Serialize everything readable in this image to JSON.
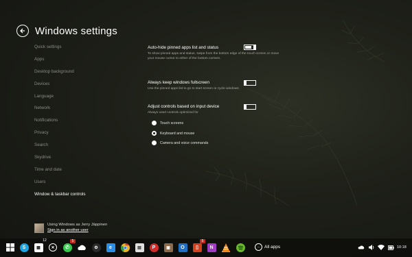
{
  "header": {
    "title": "Windows settings"
  },
  "sidebar": {
    "items": [
      {
        "label": "Quick settings"
      },
      {
        "label": "Apps"
      },
      {
        "label": "Desktop background"
      },
      {
        "label": "Devices"
      },
      {
        "label": "Language"
      },
      {
        "label": "Network"
      },
      {
        "label": "Notifications"
      },
      {
        "label": "Privacy"
      },
      {
        "label": "Search"
      },
      {
        "label": "Skydrive"
      },
      {
        "label": "Time and date"
      },
      {
        "label": "Users"
      },
      {
        "label": "Window & taskbar controls",
        "active": true
      }
    ]
  },
  "user": {
    "line1": "Using Windows as Jerry Jäppinen",
    "line2": "Sign in as another user"
  },
  "settings": {
    "autohide": {
      "title": "Auto-hide pinned apps list and status",
      "desc": "To show pinned apps and status, swipe from the bottom edge of the touch screen or move your mouse cursor to either of the bottom corners.",
      "state": "on"
    },
    "fullscreen": {
      "title": "Always keep windows fullscreen",
      "desc": "Use the pinned apps list to go to start screen or cycle windows.",
      "state": "off"
    },
    "adjust": {
      "title": "Adjust controls based on input device",
      "desc": "Always used controls optimized for",
      "state": "off",
      "options": [
        {
          "label": "Touch screens",
          "selected": false
        },
        {
          "label": "Keyboard and mouse",
          "selected": true
        },
        {
          "label": "Camera and voice commands",
          "selected": false
        }
      ]
    }
  },
  "taskbar": {
    "icons": [
      {
        "name": "windows-start-icon",
        "color": "#ffffff"
      },
      {
        "name": "skype-icon",
        "color": "#1aa3e0"
      },
      {
        "name": "calendar-icon",
        "color": "#ffffff",
        "badge": "12"
      },
      {
        "name": "xbox-icon",
        "color": "#ffffff"
      },
      {
        "name": "whatsapp-icon",
        "color": "#35c94d",
        "badge": "5"
      },
      {
        "name": "onedrive-icon",
        "color": "#ffffff"
      },
      {
        "name": "steam-icon",
        "color": "#d7d7d7"
      },
      {
        "name": "internet-explorer-icon",
        "color": "#2a8ee8"
      },
      {
        "name": "chrome-icon",
        "color": "#e8b623"
      },
      {
        "name": "news-icon",
        "color": "#e0e0e0"
      },
      {
        "name": "pinterest-icon",
        "color": "#d12a2a"
      },
      {
        "name": "photos-icon",
        "color": "#8a6a4a"
      },
      {
        "name": "outlook-icon",
        "color": "#1f6fc4"
      },
      {
        "name": "office-icon",
        "color": "#d2401e",
        "badge": "5"
      },
      {
        "name": "onenote-icon",
        "color": "#a03cc2"
      },
      {
        "name": "vlc-icon",
        "color": "#f08a1c"
      },
      {
        "name": "spotify-icon",
        "color": "#6ab62c"
      }
    ],
    "all_apps_label": "All apps",
    "clock": "10:18",
    "tray": [
      "cloud-icon",
      "volume-icon",
      "wifi-icon",
      "battery-icon"
    ]
  }
}
